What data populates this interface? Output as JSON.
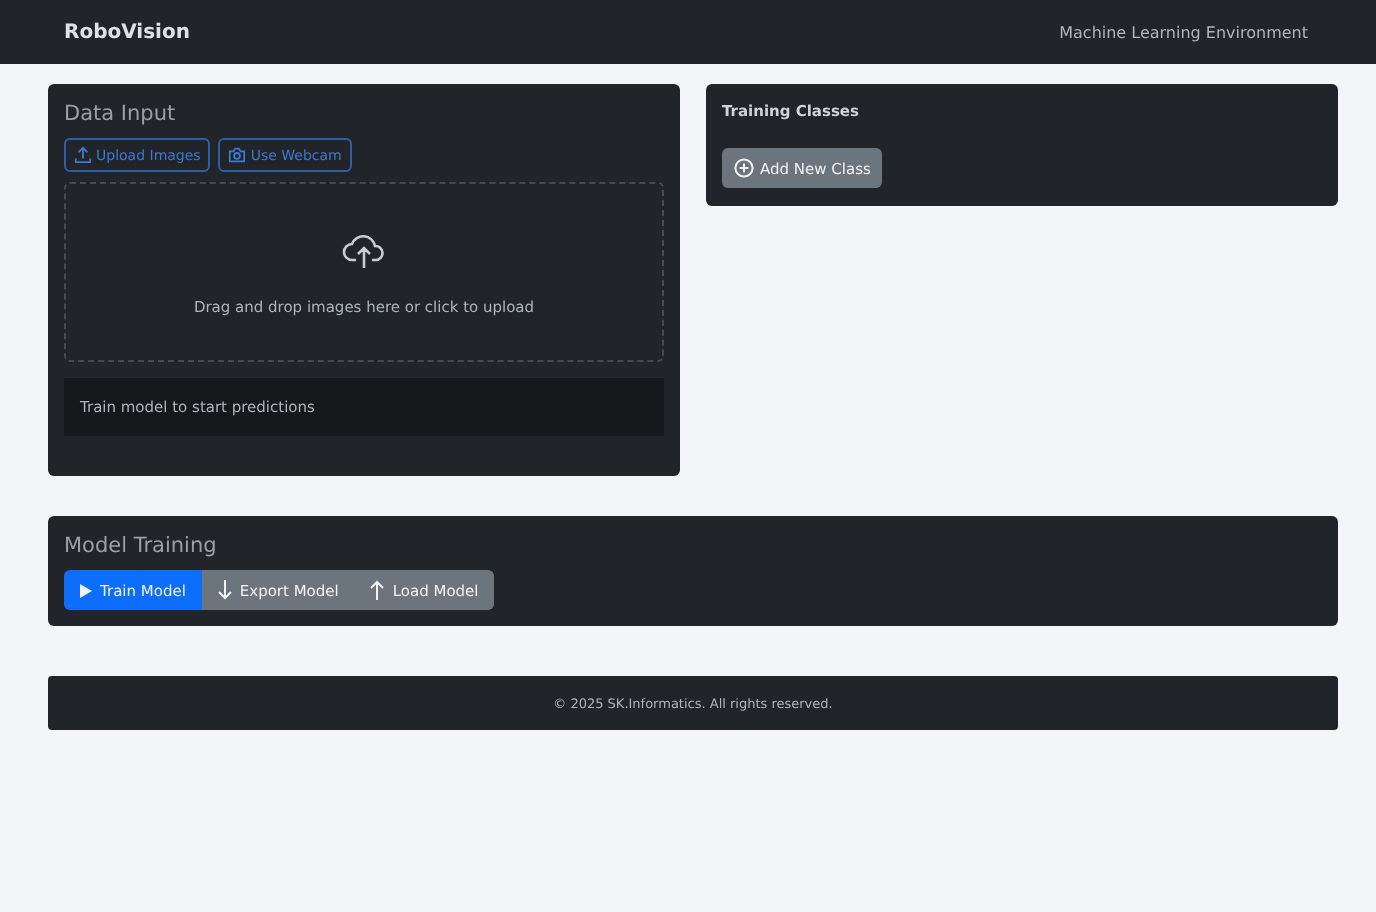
{
  "navbar": {
    "brand": "RoboVision",
    "subtitle": "Machine Learning Environment"
  },
  "data_input": {
    "title": "Data Input",
    "buttons": [
      {
        "label": "Upload Images"
      },
      {
        "label": "Use Webcam"
      }
    ],
    "dropzone_text": "Drag and drop images here or click to upload",
    "prediction_text": "Train model to start predictions"
  },
  "training_classes": {
    "title": "Training Classes",
    "add_button": "Add New Class"
  },
  "model_training": {
    "title": "Model Training",
    "buttons": [
      {
        "label": "Train Model",
        "kind": "primary"
      },
      {
        "label": "Export Model",
        "kind": "secondary"
      },
      {
        "label": "Load Model",
        "kind": "secondary"
      }
    ]
  },
  "footer": "© 2025 SK.Informatics. All rights reserved."
}
